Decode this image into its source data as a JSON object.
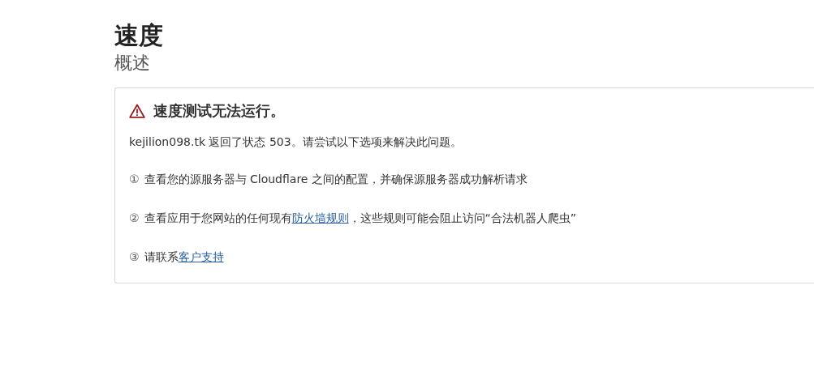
{
  "page": {
    "title": "速度",
    "subtitle": "概述"
  },
  "alert": {
    "heading": "速度测试无法运行。",
    "message": "kejilion098.tk 返回了状态 503。请尝试以下选项来解决此问题。",
    "steps": [
      {
        "number": "①",
        "segments": [
          {
            "kind": "text",
            "text": "查看您的源服务器与 Cloudflare 之间的配置，并确保源服务器成功解析请求"
          }
        ]
      },
      {
        "number": "②",
        "segments": [
          {
            "kind": "text",
            "text": "查看应用于您网站的任何现有"
          },
          {
            "kind": "link",
            "text": "防火墙规则"
          },
          {
            "kind": "text",
            "text": "，这些规则可能会阻止访问“合法机器人爬虫”"
          }
        ]
      },
      {
        "number": "③",
        "segments": [
          {
            "kind": "text",
            "text": "请联系"
          },
          {
            "kind": "link",
            "text": "客户支持"
          }
        ]
      }
    ]
  }
}
